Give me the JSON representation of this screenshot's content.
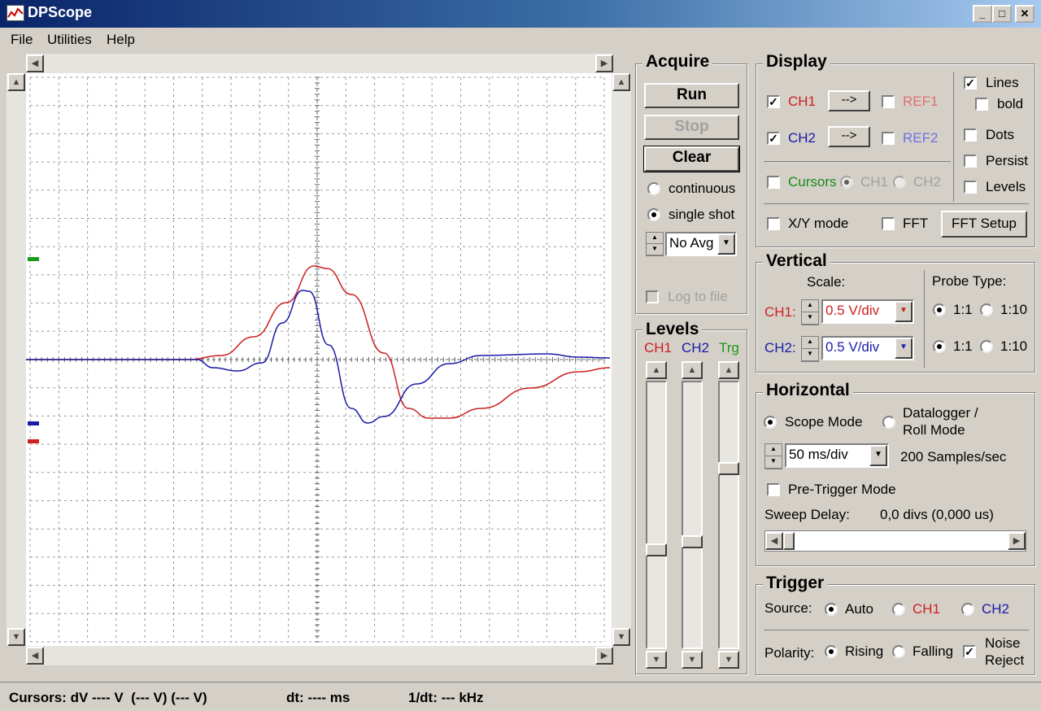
{
  "window": {
    "title": "DPScope",
    "min_label": "_",
    "max_label": "□",
    "close_label": "✕"
  },
  "menu": {
    "file": "File",
    "utilities": "Utilities",
    "help": "Help"
  },
  "acquire": {
    "title": "Acquire",
    "run": "Run",
    "stop": "Stop",
    "clear": "Clear",
    "continuous": "continuous",
    "single_shot": "single shot",
    "avg_value": "No Avg",
    "log_to_file": "Log to file"
  },
  "levels": {
    "title": "Levels",
    "ch1": "CH1",
    "ch2": "CH2",
    "trg": "Trg",
    "ch1_level": 0.4,
    "ch2_level": 0.42,
    "trg_level": 0.66
  },
  "display": {
    "title": "Display",
    "ch1": "CH1",
    "ch2": "CH2",
    "arrow": "-->",
    "ref1": "REF1",
    "ref2": "REF2",
    "cursors": "Cursors",
    "cursor_ch1": "CH1",
    "cursor_ch2": "CH2",
    "lines": "Lines",
    "bold": "bold",
    "dots": "Dots",
    "persist": "Persist",
    "levels": "Levels",
    "xy_mode": "X/Y mode",
    "fft": "FFT",
    "fft_setup": "FFT Setup"
  },
  "vertical": {
    "title": "Vertical",
    "scale_label": "Scale:",
    "probe_label": "Probe Type:",
    "ch1_label": "CH1:",
    "ch2_label": "CH2:",
    "ch1_scale": "0.5 V/div",
    "ch2_scale": "0.5 V/div",
    "p11": "1:1",
    "p110": "1:10"
  },
  "horizontal": {
    "title": "Horizontal",
    "scope_mode": "Scope Mode",
    "datalogger": "Datalogger /",
    "roll_mode": "Roll Mode",
    "timebase": "50 ms/div",
    "samples": "200 Samples/sec",
    "pretrigger": "Pre-Trigger Mode",
    "sweep_label": "Sweep Delay:",
    "sweep_value": "0,0 divs (0,000 us)"
  },
  "trigger": {
    "title": "Trigger",
    "source_label": "Source:",
    "auto": "Auto",
    "ch1": "CH1",
    "ch2": "CH2",
    "polarity_label": "Polarity:",
    "rising": "Rising",
    "falling": "Falling",
    "noise": "Noise",
    "reject": "Reject"
  },
  "status": {
    "cursors": "Cursors: dV ---- V  (--- V) (--- V)",
    "dt": "dt: ---- ms",
    "inv_dt": "1/dt: --- kHz"
  },
  "colors": {
    "ch1": "#cc2020",
    "ch2": "#1a1aa8",
    "trg": "#1b9a1b",
    "ref": "#e07070",
    "ref2": "#7070e0"
  }
}
